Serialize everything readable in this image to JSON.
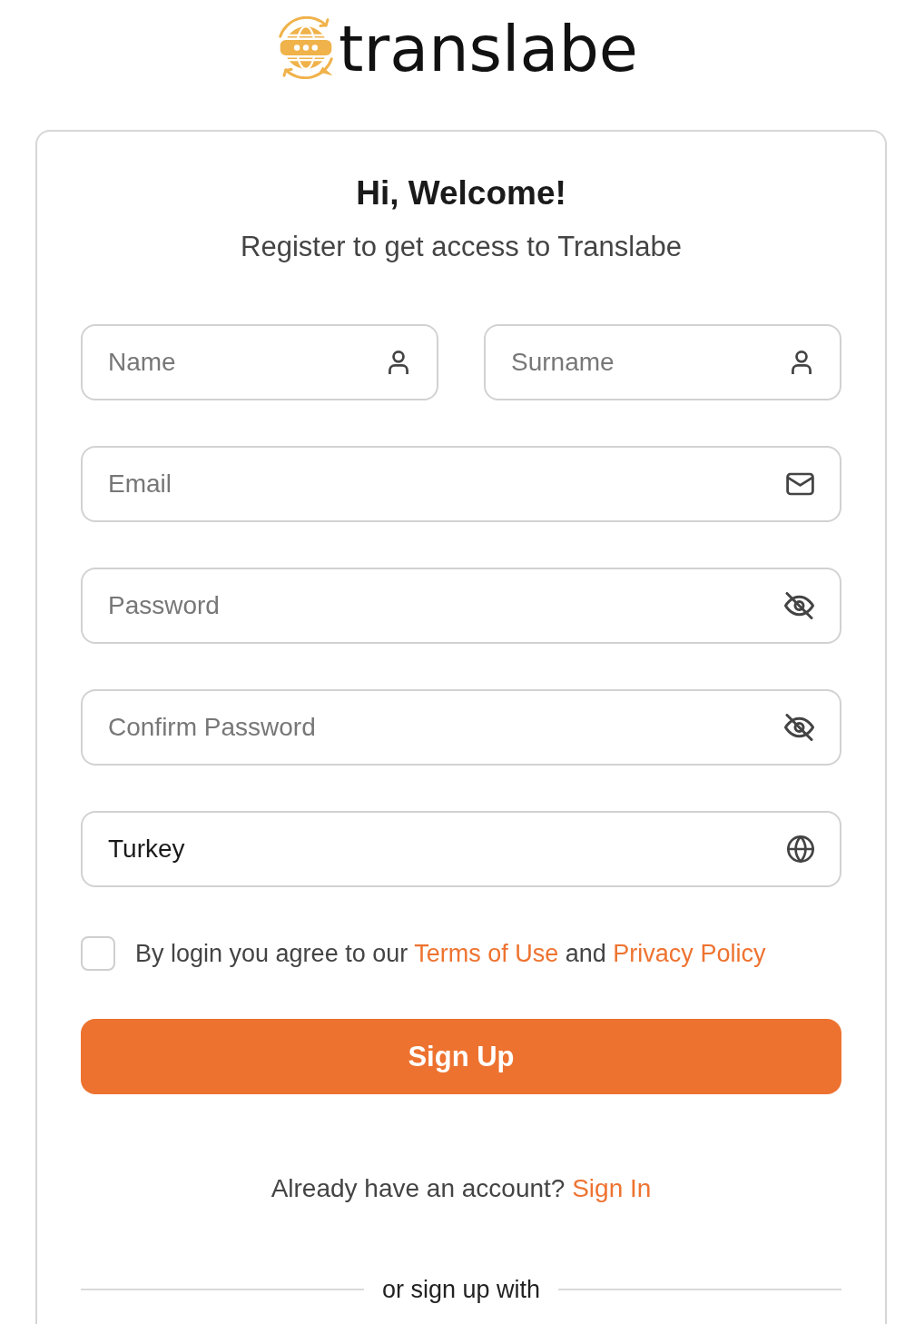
{
  "logo": {
    "text": "translabe"
  },
  "heading": {
    "title": "Hi, Welcome!",
    "subtitle": "Register to get access to Translabe"
  },
  "field_rows": [
    [
      {
        "kind": "firstname",
        "placeholder": "Name"
      },
      {
        "kind": "surname",
        "placeholder": "Surname"
      }
    ],
    [
      {
        "kind": "email",
        "placeholder": "Email"
      }
    ],
    [
      {
        "kind": "password",
        "placeholder": "Password",
        "revealed": false
      }
    ],
    [
      {
        "kind": "confirm",
        "placeholder": "Confirm Password",
        "revealed": false
      }
    ],
    [
      {
        "kind": "country",
        "value": "Turkey"
      }
    ]
  ],
  "agreement": {
    "checked": false,
    "parts": [
      {
        "kind": "text",
        "text": "By login you agree to our"
      },
      {
        "kind": "link",
        "text": "Terms of Use"
      },
      {
        "kind": "text",
        "text": "and"
      },
      {
        "kind": "link",
        "text": "Privacy Policy"
      }
    ]
  },
  "submit_button": {
    "label": "Sign Up"
  },
  "signin_prompt": {
    "text": "Already have an account?",
    "link": "Sign In"
  },
  "divider": {
    "text": "or sign up with"
  }
}
